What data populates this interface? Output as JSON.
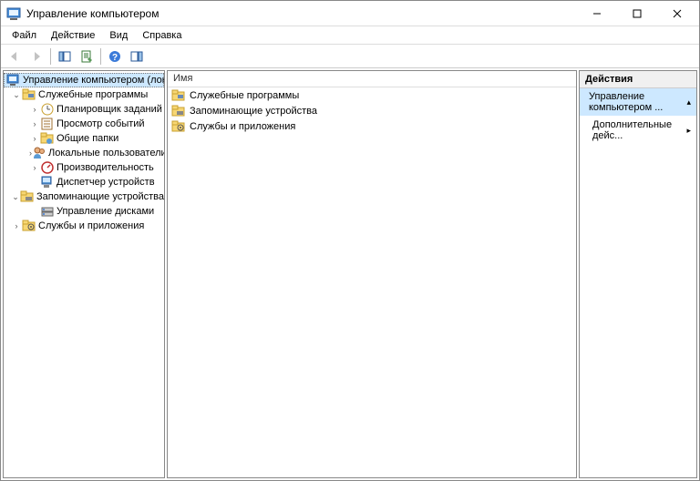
{
  "window": {
    "title": "Управление компьютером"
  },
  "menubar": {
    "file": "Файл",
    "action": "Действие",
    "view": "Вид",
    "help": "Справка"
  },
  "left_tree": {
    "root": "Управление компьютером (локальным)",
    "group_services": "Служебные программы",
    "sched": "Планировщик заданий",
    "eventv": "Просмотр событий",
    "shared": "Общие папки",
    "users": "Локальные пользователи и группы",
    "perf": "Производительность",
    "devmgr": "Диспетчер устройств",
    "group_storage": "Запоминающие устройства",
    "diskmgmt": "Управление дисками",
    "apps": "Службы и приложения"
  },
  "center": {
    "col_name": "Имя",
    "item_services": "Служебные программы",
    "item_storage": "Запоминающие устройства",
    "item_apps": "Службы и приложения"
  },
  "actions": {
    "header": "Действия",
    "current": "Управление компьютером ...",
    "more": "Дополнительные дейс..."
  }
}
